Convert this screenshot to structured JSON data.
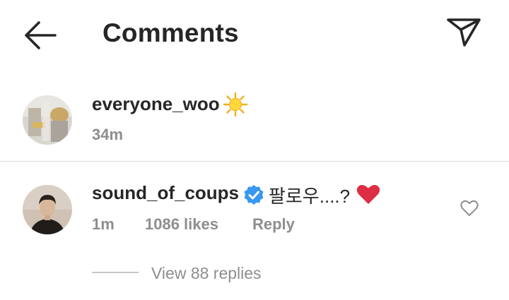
{
  "header": {
    "back_icon": "arrow-left-icon",
    "title": "Comments",
    "send_icon": "paper-plane-icon"
  },
  "caption": {
    "username": "everyone_woo",
    "emoji_icon": "sun-emoji-icon",
    "time": "34m"
  },
  "comment": {
    "username": "sound_of_coups",
    "verified_icon": "verified-badge-icon",
    "text": "팔로우....?",
    "emoji_icon": "red-heart-emoji-icon",
    "time": "1m",
    "likes": "1086 likes",
    "reply_label": "Reply",
    "like_icon": "heart-outline-icon",
    "view_replies": "View 88 replies"
  },
  "colors": {
    "text_primary": "#262626",
    "text_secondary": "#8e8e8e",
    "verified_blue": "#3897f0",
    "heart_red": "#e0245e",
    "divider": "#dbdbdb"
  }
}
